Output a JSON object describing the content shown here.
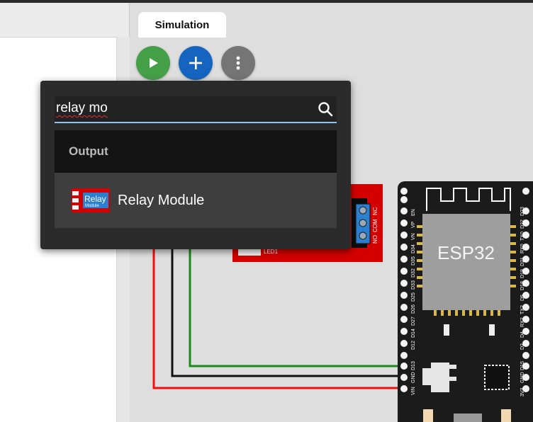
{
  "tabs": {
    "simulation": "Simulation"
  },
  "toolbar": {
    "run_icon": "play-icon",
    "add_icon": "plus-icon",
    "more_icon": "more-vertical-icon",
    "colors": {
      "run": "#43a047",
      "add": "#1565c0",
      "more": "#757575"
    }
  },
  "search": {
    "value": "relay mo",
    "icon": "search-icon"
  },
  "results": {
    "category": "Output",
    "items": [
      {
        "label": "Relay Module",
        "thumb_text": "Relay",
        "thumb_sub": "Module"
      }
    ]
  },
  "relay_board": {
    "terminals": [
      "NO",
      "COM",
      "NC"
    ],
    "led_label": "LED1",
    "color": "#d40000"
  },
  "esp32": {
    "chip_label": "ESP32",
    "left_pins": [
      "EN",
      "VP",
      "VN",
      "D34",
      "D35",
      "D32",
      "D33",
      "D25",
      "D26",
      "D27",
      "D14",
      "D12",
      "D13",
      "GND",
      "VIN"
    ],
    "right_pins": [
      "D23",
      "D22",
      "TX0",
      "RX0",
      "D21",
      "D19",
      "D18",
      "D5",
      "TX2",
      "RX2",
      "D4",
      "D2",
      "D15",
      "GND",
      "3V3"
    ]
  },
  "wires": {
    "colors": [
      "#1a8a1a",
      "#111111",
      "#ee1111"
    ]
  }
}
